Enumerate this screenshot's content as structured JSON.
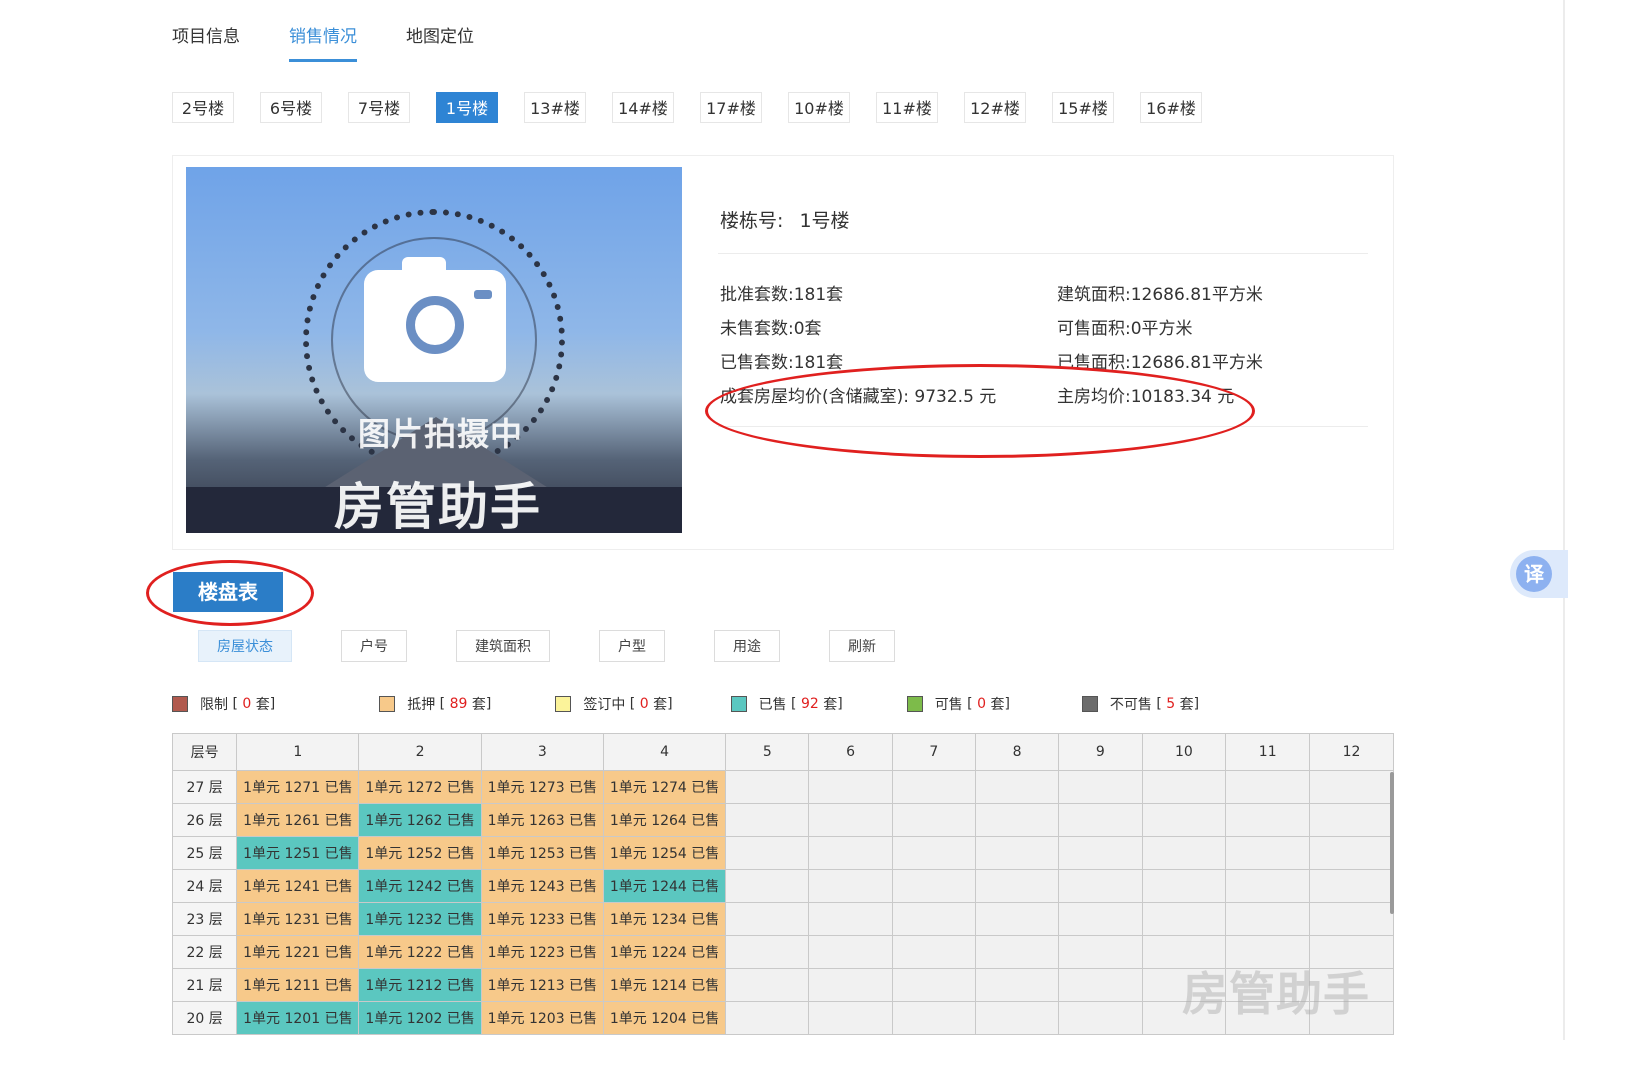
{
  "tabs": [
    "项目信息",
    "销售情况",
    "地图定位"
  ],
  "buildings": [
    "2号楼",
    "6号楼",
    "7号楼",
    "1号楼",
    "13#楼",
    "14#楼",
    "17#楼",
    "10#楼",
    "11#楼",
    "12#楼",
    "15#楼",
    "16#楼"
  ],
  "active_building": "1号楼",
  "photo": {
    "caption1": "图片拍摄中",
    "caption2": "房管助手"
  },
  "info": {
    "building_label": "楼栋号:",
    "building_value": "1号楼",
    "approved": "批准套数:181套",
    "unsold": "未售套数:0套",
    "sold": "已售套数:181套",
    "avg_price": "成套房屋均价(含储藏室): 9732.5 元",
    "area_total": "建筑面积:12686.81平方米",
    "area_saleable": "可售面积:0平方米",
    "area_sold": "已售面积:12686.81平方米",
    "main_price": "主房均价:10183.34 元"
  },
  "lpb_button": "楼盘表",
  "filters": [
    "房屋状态",
    "户号",
    "建筑面积",
    "户型",
    "用途",
    "刷新"
  ],
  "legend": [
    {
      "name": "限制",
      "count": "0",
      "color": "#b15a4e"
    },
    {
      "name": "抵押",
      "count": "89",
      "color": "#f7c98a"
    },
    {
      "name": "签订中",
      "count": "0",
      "color": "#fbf39a"
    },
    {
      "name": "已售",
      "count": "92",
      "color": "#5bc7c0"
    },
    {
      "name": "可售",
      "count": "0",
      "color": "#7dbb4a"
    },
    {
      "name": "不可售",
      "count": "5",
      "color": "#6c6c6c"
    }
  ],
  "legend_unit": "套",
  "table": {
    "header_floor": "层号",
    "columns": [
      "1",
      "2",
      "3",
      "4",
      "5",
      "6",
      "7",
      "8",
      "9",
      "10",
      "11",
      "12"
    ],
    "rows": [
      {
        "floor": "27 层",
        "cells": [
          [
            "1单元 1271 已售",
            "m"
          ],
          [
            "1单元 1272 已售",
            "m"
          ],
          [
            "1单元 1273 已售",
            "m"
          ],
          [
            "1单元 1274 已售",
            "m"
          ]
        ]
      },
      {
        "floor": "26 层",
        "cells": [
          [
            "1单元 1261 已售",
            "m"
          ],
          [
            "1单元 1262 已售",
            "s"
          ],
          [
            "1单元 1263 已售",
            "m"
          ],
          [
            "1单元 1264 已售",
            "m"
          ]
        ]
      },
      {
        "floor": "25 层",
        "cells": [
          [
            "1单元 1251 已售",
            "s"
          ],
          [
            "1单元 1252 已售",
            "m"
          ],
          [
            "1单元 1253 已售",
            "m"
          ],
          [
            "1单元 1254 已售",
            "m"
          ]
        ]
      },
      {
        "floor": "24 层",
        "cells": [
          [
            "1单元 1241 已售",
            "m"
          ],
          [
            "1单元 1242 已售",
            "s"
          ],
          [
            "1单元 1243 已售",
            "m"
          ],
          [
            "1单元 1244 已售",
            "s"
          ]
        ]
      },
      {
        "floor": "23 层",
        "cells": [
          [
            "1单元 1231 已售",
            "m"
          ],
          [
            "1单元 1232 已售",
            "s"
          ],
          [
            "1单元 1233 已售",
            "m"
          ],
          [
            "1单元 1234 已售",
            "m"
          ]
        ]
      },
      {
        "floor": "22 层",
        "cells": [
          [
            "1单元 1221 已售",
            "m"
          ],
          [
            "1单元 1222 已售",
            "m"
          ],
          [
            "1单元 1223 已售",
            "m"
          ],
          [
            "1单元 1224 已售",
            "m"
          ]
        ]
      },
      {
        "floor": "21 层",
        "cells": [
          [
            "1单元 1211 已售",
            "m"
          ],
          [
            "1单元 1212 已售",
            "s"
          ],
          [
            "1单元 1213 已售",
            "m"
          ],
          [
            "1单元 1214 已售",
            "m"
          ]
        ]
      },
      {
        "floor": "20 层",
        "cells": [
          [
            "1单元 1201 已售",
            "s"
          ],
          [
            "1单元 1202 已售",
            "s"
          ],
          [
            "1单元 1203 已售",
            "m"
          ],
          [
            "1单元 1204 已售",
            "m"
          ]
        ]
      }
    ]
  },
  "watermark": "房管助手",
  "translate_label": "译"
}
